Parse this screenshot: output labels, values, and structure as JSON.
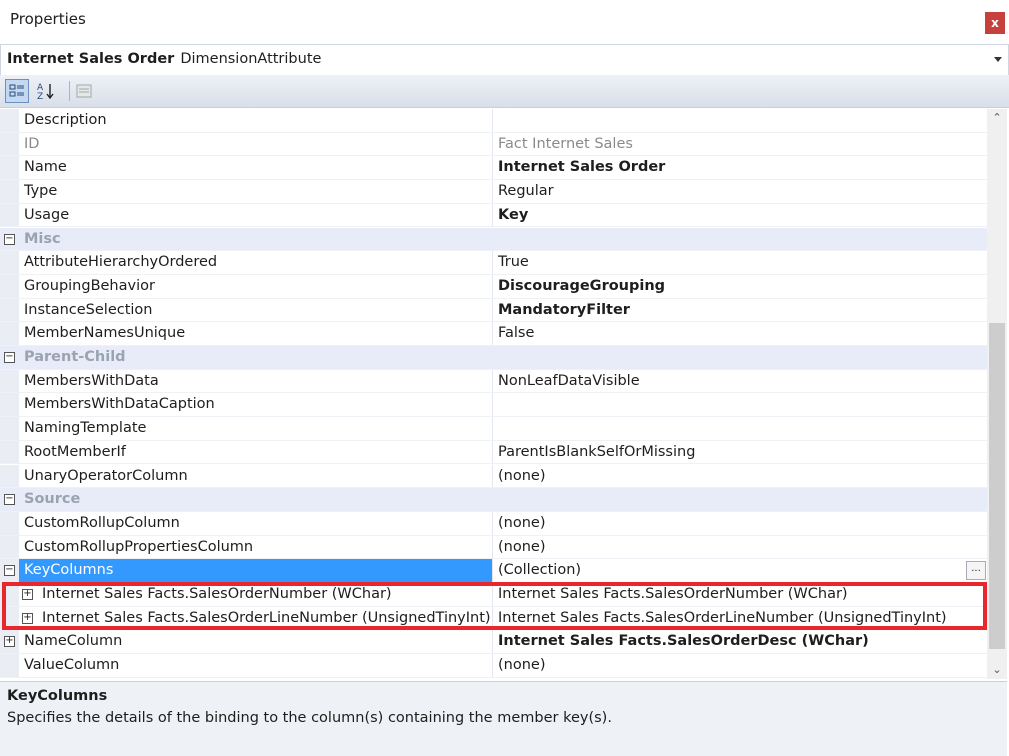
{
  "window": {
    "title": "Properties",
    "close_glyph": "x"
  },
  "object": {
    "name": "Internet Sales Order",
    "type": "DimensionAttribute"
  },
  "toolbar": {
    "categorized_icon": "categorized-icon",
    "alphabetical_icon": "alphabetical-icon",
    "property_pages_icon": "property-pages-icon"
  },
  "rows": [
    {
      "name": "Description",
      "value": ""
    },
    {
      "name": "ID",
      "value": "Fact Internet Sales"
    },
    {
      "name": "Name",
      "value": "Internet Sales Order"
    },
    {
      "name": "Type",
      "value": "Regular"
    },
    {
      "name": "Usage",
      "value": "Key"
    },
    {
      "name": "Misc",
      "value": ""
    },
    {
      "name": "AttributeHierarchyOrdered",
      "value": "True"
    },
    {
      "name": "GroupingBehavior",
      "value": "DiscourageGrouping"
    },
    {
      "name": "InstanceSelection",
      "value": "MandatoryFilter"
    },
    {
      "name": "MemberNamesUnique",
      "value": "False"
    },
    {
      "name": "Parent-Child",
      "value": ""
    },
    {
      "name": "MembersWithData",
      "value": "NonLeafDataVisible"
    },
    {
      "name": "MembersWithDataCaption",
      "value": ""
    },
    {
      "name": "NamingTemplate",
      "value": ""
    },
    {
      "name": "RootMemberIf",
      "value": "ParentIsBlankSelfOrMissing"
    },
    {
      "name": "UnaryOperatorColumn",
      "value": "(none)"
    },
    {
      "name": "Source",
      "value": ""
    },
    {
      "name": "CustomRollupColumn",
      "value": "(none)"
    },
    {
      "name": "CustomRollupPropertiesColumn",
      "value": "(none)"
    },
    {
      "name": "KeyColumns",
      "value": "(Collection)",
      "button": "..."
    },
    {
      "name": "Internet Sales Facts.SalesOrderNumber (WChar)",
      "value": "Internet Sales Facts.SalesOrderNumber (WChar)"
    },
    {
      "name": "Internet Sales Facts.SalesOrderLineNumber (UnsignedTinyInt)",
      "value": "Internet Sales Facts.SalesOrderLineNumber (UnsignedTinyInt)"
    },
    {
      "name": "NameColumn",
      "value": "Internet Sales Facts.SalesOrderDesc (WChar)"
    },
    {
      "name": "ValueColumn",
      "value": "(none)"
    }
  ],
  "description": {
    "title": "KeyColumns",
    "text": "Specifies the details of the binding to the column(s) containing the member key(s)."
  },
  "colors": {
    "selection": "#3399ff",
    "highlight_border": "#e8262b",
    "category_bg": "#e8ecf8"
  }
}
